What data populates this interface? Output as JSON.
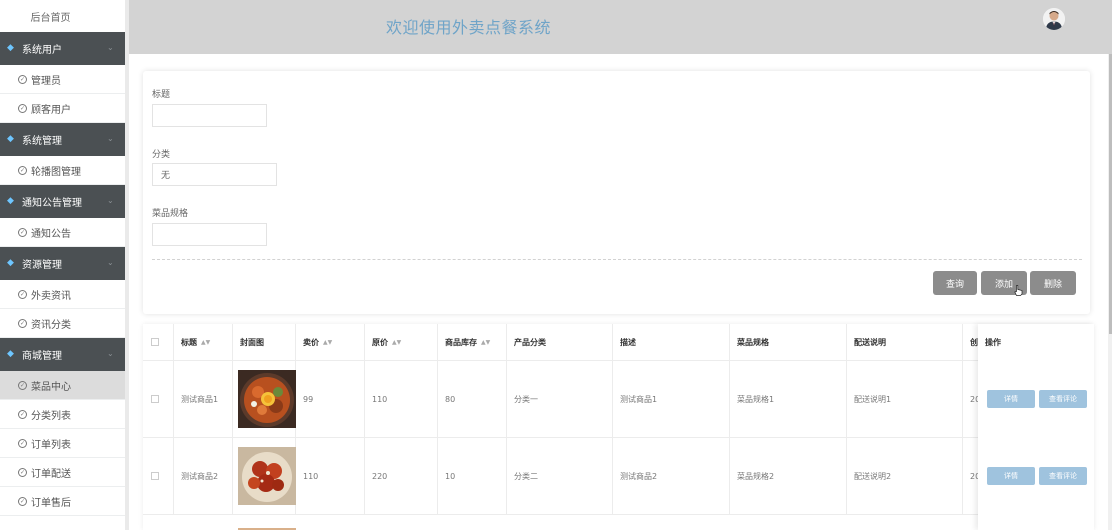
{
  "sidebar": {
    "home": "后台首页",
    "groups": [
      {
        "label": "系统用户",
        "items": [
          "管理员",
          "顾客用户"
        ]
      },
      {
        "label": "系统管理",
        "items": [
          "轮播图管理"
        ]
      },
      {
        "label": "通知公告管理",
        "items": [
          "通知公告"
        ]
      },
      {
        "label": "资源管理",
        "items": [
          "外卖资讯",
          "资讯分类"
        ]
      },
      {
        "label": "商城管理",
        "items": [
          "菜品中心",
          "分类列表",
          "订单列表",
          "订单配送",
          "订单售后"
        ]
      }
    ]
  },
  "header": {
    "title": "欢迎使用外卖点餐系统"
  },
  "search": {
    "title_label": "标题",
    "title_value": "",
    "category_label": "分类",
    "category_value": "无",
    "spec_label": "菜品规格",
    "spec_value": "",
    "query_label": "查询",
    "add_label": "添加",
    "delete_label": "删除"
  },
  "table": {
    "headers": [
      "标题",
      "封面图",
      "卖价",
      "原价",
      "商品库存",
      "产品分类",
      "描述",
      "菜品规格",
      "配送说明",
      "创",
      "操作"
    ],
    "rows": [
      {
        "title": "测试商品1",
        "price": "99",
        "orig": "110",
        "stock": "80",
        "category": "分类一",
        "desc": "测试商品1",
        "spec": "菜品规格1",
        "delivery": "配送说明1",
        "created": "20"
      },
      {
        "title": "测试商品2",
        "price": "110",
        "orig": "220",
        "stock": "10",
        "category": "分类二",
        "desc": "测试商品2",
        "spec": "菜品规格2",
        "delivery": "配送说明2",
        "created": "20"
      }
    ],
    "detail_label": "详情",
    "review_label": "查看评论"
  },
  "colors": {
    "sidebar_group": "#4b5053",
    "header_bg": "#d3d3d3",
    "title": "#6fa4c8",
    "button_gray": "#8c8c8c",
    "op_button": "#9fc3de"
  }
}
